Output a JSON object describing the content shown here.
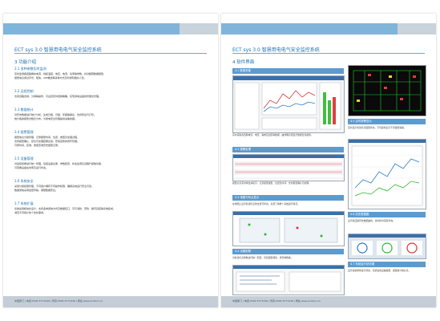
{
  "footer": "中国厦门 | 电话:0592-5771246 | 传真:0592-5771246 | 网址:www.ecoteco.cn",
  "left": {
    "title": "ECT sys 3.0 智慧用电电气安全监控系统",
    "section": "3 功能介绍",
    "blocks": [
      {
        "head": "3.1 多种参数实时监测",
        "lines": [
          "实时监测各回路剩余电流、线缆温度、电压、电流、功率等参数，并对超限数据报警，",
          "报警信息通过声光、短信、APP推送等多种方式及时通知相关人员。"
        ]
      },
      {
        "head": "3.2 远程控制",
        "lines": [
          "支持远程合闸、分闸等操作，可设置定时控制策略，实现用电设备的智能化管理。"
        ]
      },
      {
        "head": "3.3 数据统计",
        "lines": [
          "对历史数据进行统计分析，生成日报、月报、年报等报表，支持导出与打印。",
          "统计各类报警次数及分布，为用电安全管理提供决策依据。"
        ]
      },
      {
        "head": "3.4 报警管理",
        "lines": [
          "报警信息分级管理，记录报警时间、位置、类型及处理过程，",
          "支持报警确认、复位与处理结果反馈，形成完整的闭环管理。",
          "可按时间、区域、类型查询历史报警记录。"
        ]
      },
      {
        "head": "3.5 设备管理",
        "lines": [
          "对监控终端进行统一管理，包括设备注册、参数配置、状态监测及远程升级等功能，",
          "可查看设备在线率及运行状态。"
        ]
      },
      {
        "head": "3.6 系统安全",
        "lines": [
          "采用分级权限管理，不同用户拥有不同操作权限，确保系统运行安全可靠。",
          "数据通信采用加密传输，保障数据安全。"
        ]
      },
      {
        "head": "3.7 系统扩展",
        "lines": [
          "系统采用模块化设计，支持多种通信方式及数据接口，可与消防、安防、楼宇自控等系统集成，",
          "满足不同用户的个性化需求。"
        ]
      }
    ]
  },
  "right": {
    "title": "ECT sys 3.0 智慧用电电气安全监控系统",
    "section": "4 软件界面",
    "bars": [
      "4.1 数据采集",
      "4.2 报警处理",
      "4.3 地图与布点显示",
      "4.4 设备配置",
      "4.5 实时报警显示",
      "4.6 历史数据图",
      "4.7 系统运行状态图"
    ],
    "captions": [
      "实时采集各回路电流、电压、漏电及温度等数据，曲线图直观显示数据变化趋势。",
      "报警信息实时弹出并提示，记录报警类型、位置及时间，支持报警确认与处理。",
      "在地图上显示各监控点的位置与状态，直观了解整个系统运行情况。",
      "对各监控点参数进行统一配置，包括报警阈值、通讯参数等。",
      "实时显示各监控点报警状态，不同颜色表示不同报警等级。",
      "显示各回路历史数据曲线，支持按时间段查询。",
      "显示系统整体运行状态，包括在线设备数量、报警统计等信息。"
    ]
  }
}
